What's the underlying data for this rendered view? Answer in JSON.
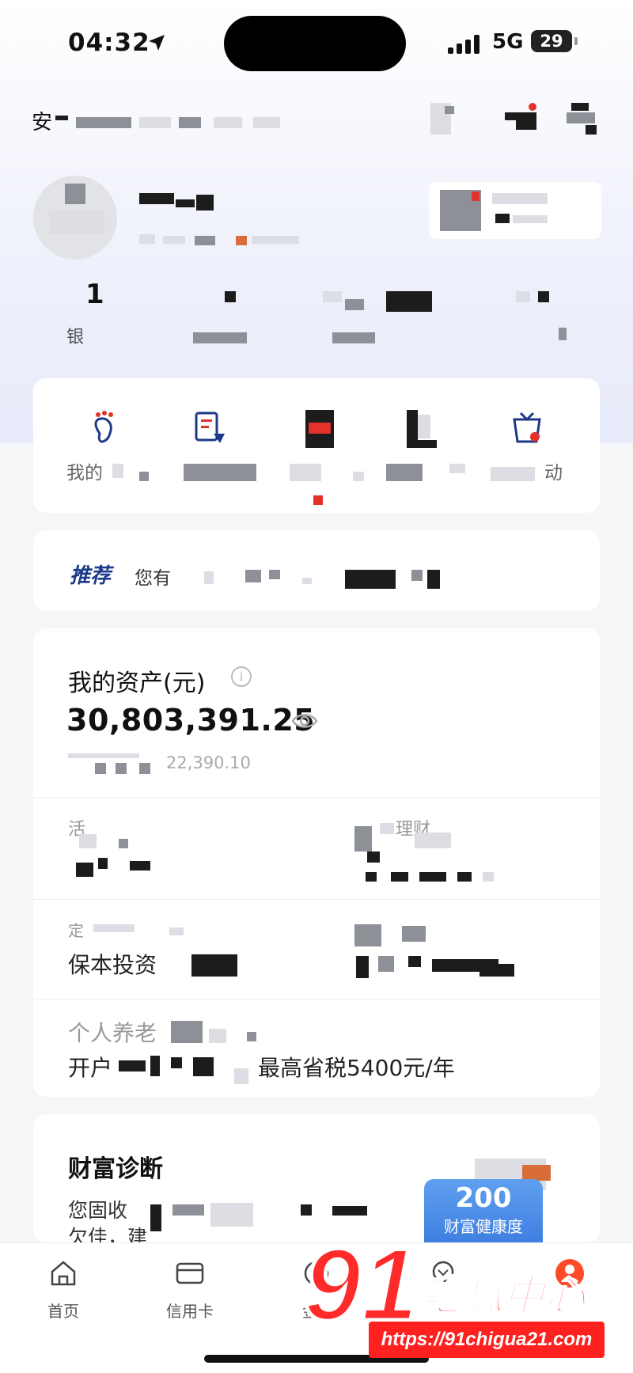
{
  "status_bar": {
    "time": "04:32",
    "network": "5G",
    "battery": "29"
  },
  "header": {
    "title_fragment": "安"
  },
  "stats": [
    {
      "value": "1",
      "label_fragment": "银"
    }
  ],
  "quick_actions": {
    "first_label_fragment": "我的",
    "last_label_fragment": "动"
  },
  "recommend": {
    "tag": "推荐",
    "text_fragment": "您有"
  },
  "assets": {
    "title": "我的资产(元)",
    "total": "30,803,391.25",
    "sub_fragment": "22,390.10",
    "row1_left_fragment": "活",
    "row1_right_fragment": "理财",
    "row2_left_fragment": "定",
    "row2_left_text": "保本投资",
    "row3_title_fragment": "个人养老",
    "row3_text_start": "开户",
    "row3_text_end": "最高省税5400元/年"
  },
  "wealth": {
    "title": "财富诊断",
    "line1_fragment": "您固收",
    "line2_fragment": "欠佳，建",
    "badge_num": "200",
    "badge_caption": "财富健康度"
  },
  "tabbar": {
    "tabs": [
      {
        "label": "首页",
        "icon": "home-icon"
      },
      {
        "label": "信用卡",
        "icon": "card-icon"
      },
      {
        "label": "金",
        "icon": "chat-icon"
      },
      {
        "label": "",
        "icon": "wealth-icon"
      },
      {
        "label": "",
        "icon": "profile-icon"
      }
    ]
  },
  "watermark": {
    "number": "91",
    "name": "吃瓜中心",
    "url": "https://91chigua21.com"
  },
  "colors": {
    "accent": "#e3312b",
    "brand_blue": "#1d3a8a"
  }
}
